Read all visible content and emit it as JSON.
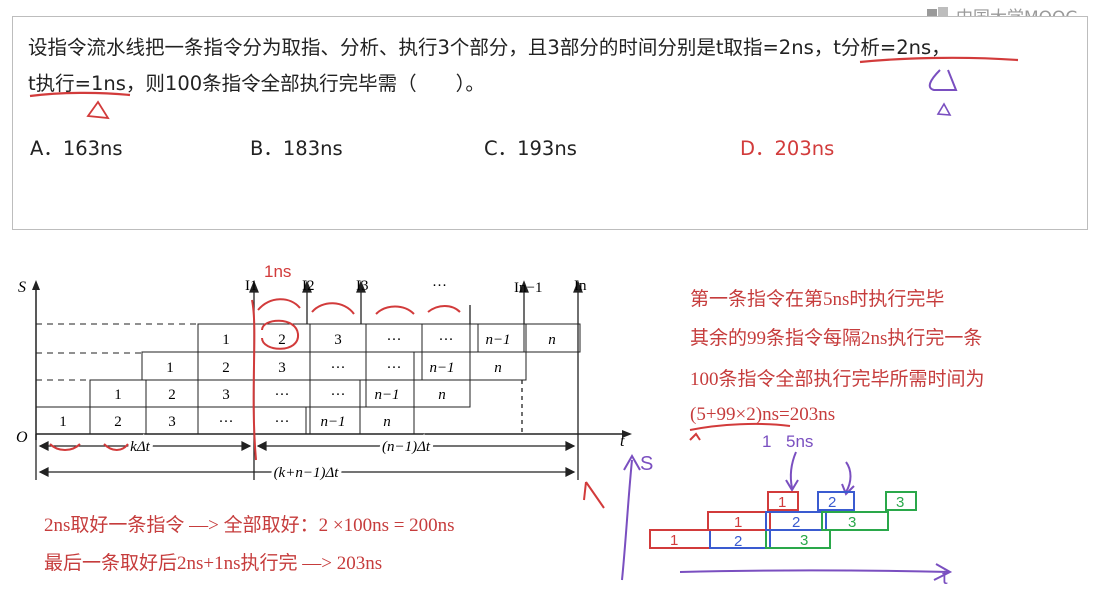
{
  "watermark": "中国大学MOOC",
  "question": {
    "line1": "设指令流水线把一条指令分为取指、分析、执行3个部分，且3部分的时间分别是t取指=2ns，t分析=2ns，",
    "line2": "t执行=1ns，则100条指令全部执行完毕需（　　）。",
    "options": [
      {
        "key": "A",
        "text": "A．163ns"
      },
      {
        "key": "B",
        "text": "B．183ns"
      },
      {
        "key": "C",
        "text": "C．193ns"
      },
      {
        "key": "D",
        "text": "D．203ns",
        "highlight": true
      }
    ]
  },
  "diagram": {
    "axis_s": "S",
    "axis_t": "t",
    "origin": "O",
    "instr_labels": [
      "I1",
      "I2",
      "I3",
      "···",
      "In−1",
      "In"
    ],
    "rows": [
      [
        "1",
        "2",
        "3",
        "···",
        "···",
        "···",
        "n−1",
        "n"
      ],
      [
        "1",
        "2",
        "3",
        "···",
        "···",
        "n−1",
        "n"
      ],
      [
        "1",
        "2",
        "3",
        "···",
        "···",
        "n−1",
        "n"
      ],
      [
        "1",
        "2",
        "3",
        "···",
        "···",
        "n−1",
        "n"
      ]
    ],
    "k_dt": "kΔt",
    "n_minus_1_dt": "(n−1)Δt",
    "total_dt": "(k+n−1)Δt"
  },
  "annotations": {
    "one_ns": "1ns",
    "five_ns": "5ns",
    "s": "S",
    "t": "t",
    "mini_blocks": [
      "1",
      "2",
      "3",
      "1",
      "2",
      "3",
      "1",
      "2",
      "3"
    ]
  },
  "notes_right": [
    "第一条指令在第5ns时执行完毕",
    "其余的99条指令每隔2ns执行完一条",
    "100条指令全部执行完毕所需时间为",
    "(5+99×2)ns=203ns"
  ],
  "notes_bottom": [
    "2ns取好一条指令 —> 全部取好：2 ×100ns = 200ns",
    "最后一条取好后2ns+1ns执行完 —> 203ns"
  ],
  "colors": {
    "red": "#d23b3b",
    "ink": "#222222",
    "blue": "#3a5bd0",
    "green": "#2aa84a",
    "purple": "#7a4fc0"
  }
}
